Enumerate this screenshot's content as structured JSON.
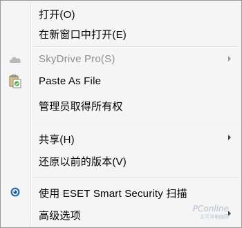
{
  "menu": {
    "items": [
      {
        "label": "打开(O)",
        "enabled": true
      },
      {
        "label": "在新窗口中打开(E)",
        "enabled": true
      },
      {
        "label": "SkyDrive Pro(S)",
        "enabled": false,
        "submenu": true,
        "icon": "cloud-icon"
      },
      {
        "label": "Paste As File",
        "enabled": true,
        "icon": "paste-file-icon"
      },
      {
        "label": "管理员取得所有权",
        "enabled": true
      },
      {
        "label": "共享(H)",
        "enabled": true,
        "submenu": true
      },
      {
        "label": "还原以前的版本(V)",
        "enabled": true
      },
      {
        "label": "使用 ESET Smart Security 扫描",
        "enabled": true,
        "icon": "eset-eye-icon"
      },
      {
        "label": "高级选项",
        "enabled": true,
        "submenu": true
      }
    ]
  },
  "watermark": {
    "main": "PConline",
    "sub": "太平洋电脑网"
  },
  "colors": {
    "menu_background": "#f5f5f5",
    "disabled_text": "#8d8d8d",
    "border": "#979797",
    "eset_blue": "#2a6fb3"
  }
}
